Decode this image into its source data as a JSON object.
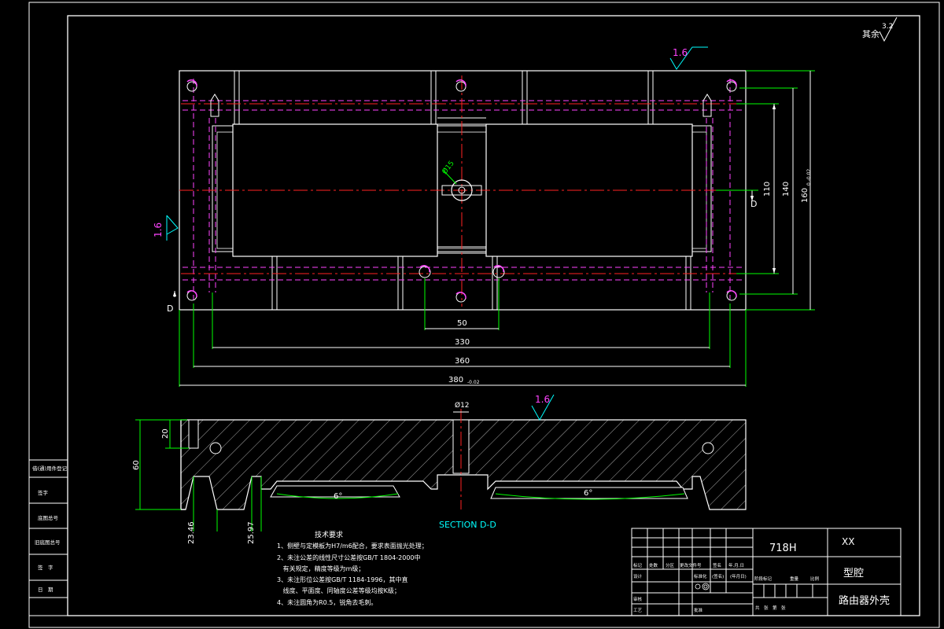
{
  "corner_note": {
    "text": "其余",
    "roughness": "3.2"
  },
  "roughness": {
    "top": "1.6",
    "left": "1.6",
    "section": "1.6"
  },
  "section_cut": {
    "letter": "D",
    "letter_left": "D"
  },
  "plan_dims": {
    "hole_dia": "Ø15",
    "d110": "110",
    "d140": "140",
    "d160": "160",
    "d160_tol": "0 -0.02",
    "d50": "50",
    "d330": "330",
    "d360": "360",
    "d380": "380",
    "d380_tol": "-0.02"
  },
  "section_dims": {
    "bore": "Ø12",
    "h20": "20",
    "h60": "60",
    "d2346": "23.46",
    "d2597": "25.97",
    "draft_left": "6°",
    "draft_right": "6°",
    "title": "SECTION D-D"
  },
  "tech": {
    "title": "技术要求",
    "lines": [
      "1、侧壁与定模板为H7/m6配合，要求表面抛光处理；",
      "2、未注公差的线性尺寸公差按GB/T 1804-2000中",
      "   有关规定，精度等级为m级；",
      "3、未注形位公差按GB/T 1184-1996，其中直",
      "   线度、平面度、同轴度公差等级均按K级；",
      "4、未注圆角为R0.5，锐角去毛刺。"
    ]
  },
  "left_strip": [
    "借(通)用件登记",
    "旧底图总号",
    "底图总号",
    "签字",
    "日期",
    "签　字",
    "日　期"
  ],
  "title_block": {
    "material": "718H",
    "company": "XX",
    "part_type": "型腔",
    "part_name": "路由器外壳",
    "row_labels": [
      "标记",
      "处数",
      "分区",
      "更改文件号",
      "签名",
      "年.月.日"
    ],
    "design": "设计",
    "standardize": "标准化",
    "signature": "(签名)",
    "date": "(年月日)",
    "stage": "阶段标记",
    "weight": "重量",
    "scale": "比例",
    "review": "审核",
    "process": "工艺",
    "approve": "批准",
    "sheets": "共　张　第　张"
  }
}
